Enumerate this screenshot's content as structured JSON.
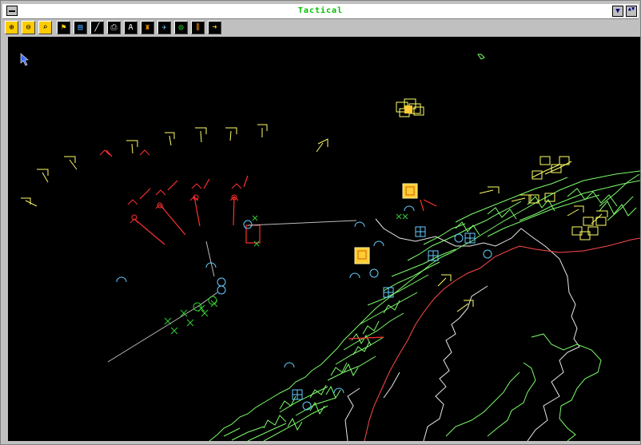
{
  "window": {
    "title": "Tactical",
    "min_glyph": "▼",
    "max_glyph": "▲▼"
  },
  "toolbar": {
    "tools": [
      {
        "name": "zoom-in-tool",
        "glyph": "⊕"
      },
      {
        "name": "zoom-out-tool",
        "glyph": "⊖"
      },
      {
        "name": "zoom-area-tool",
        "glyph": "⌕"
      },
      {
        "name": "symbol-tool",
        "glyph": "⚑"
      },
      {
        "name": "layers-tool",
        "glyph": "▤"
      },
      {
        "name": "draw-line-tool",
        "glyph": "╱"
      },
      {
        "name": "print-tool",
        "glyph": "⎙"
      },
      {
        "name": "text-tool",
        "glyph": "A"
      },
      {
        "name": "track-tool",
        "glyph": "♜"
      },
      {
        "name": "aircraft-tool",
        "glyph": "✈"
      },
      {
        "name": "radar-tool",
        "glyph": "◎"
      },
      {
        "name": "histogram-tool",
        "glyph": "⫼"
      },
      {
        "name": "navigate-tool",
        "glyph": "➜"
      }
    ]
  },
  "colors": {
    "background": "#000000",
    "coastline": "#7cfc6a",
    "border": "#ff4040",
    "inland": "#e0e0e0",
    "friendly": "#ffff66",
    "hostile": "#ff3030",
    "neutral": "#66ccff",
    "unknown_track": "#33cc33"
  }
}
